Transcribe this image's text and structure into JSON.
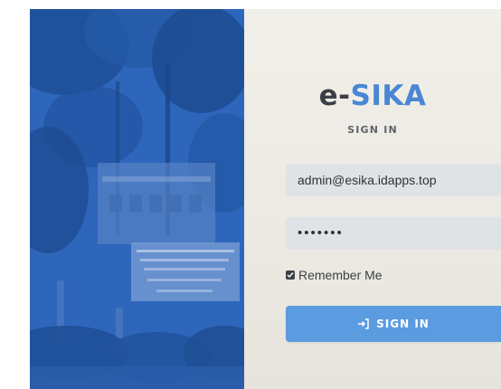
{
  "brand": {
    "prefix": "e-",
    "accent": "SIKA"
  },
  "subtitle": "SIGN IN",
  "form": {
    "email_value": "admin@esika.idapps.top",
    "password_value": "•••••••",
    "remember_label": "Remember Me",
    "remember_checked": true,
    "submit_label": "SIGN IN",
    "submit_icon": "sign-in-icon"
  },
  "colors": {
    "accent": "#4a86d4",
    "button": "#5b9be0",
    "panel_overlay": "#2f6cc4"
  }
}
